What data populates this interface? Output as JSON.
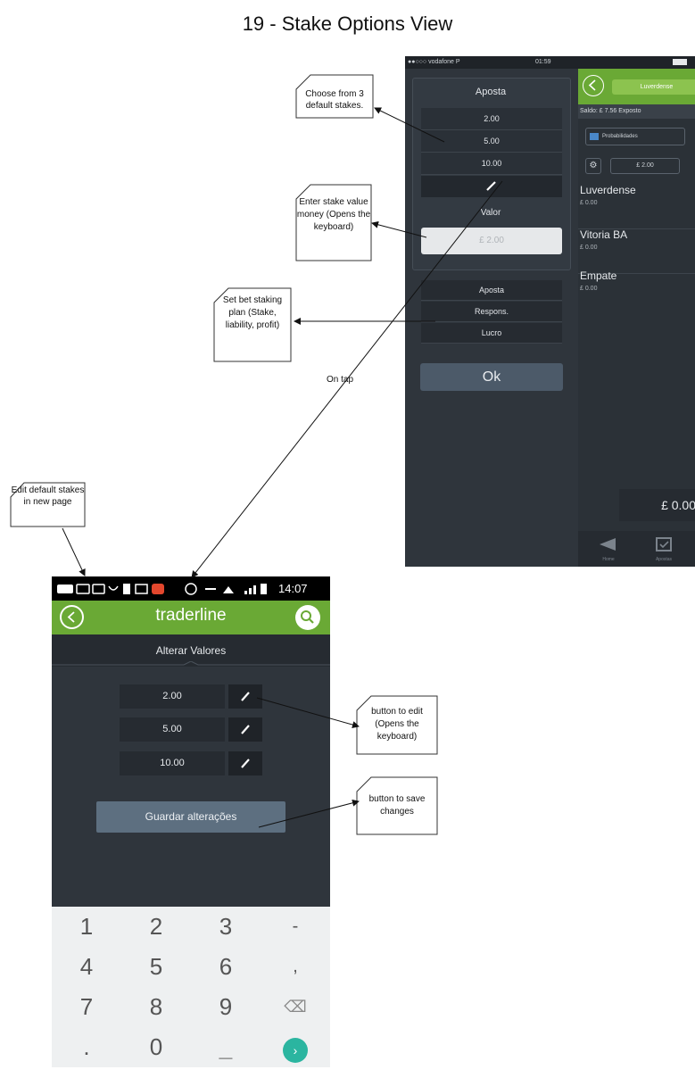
{
  "page": {
    "title": "19 - Stake Options View"
  },
  "ios": {
    "status": {
      "carrier": "●●○○○ vodafone P",
      "time": "01:59"
    },
    "popup": {
      "header": "Aposta",
      "default_stakes": [
        "2.00",
        "5.00",
        "10.00"
      ],
      "valor_label": "Valor",
      "valor_value": "£ 2.00",
      "plan_options": [
        "Aposta",
        "Respons.",
        "Lucro"
      ],
      "ok_label": "Ok"
    },
    "right": {
      "team_pill": "Luverdense",
      "saldo": "Saldo: £ 7.56    Exposto",
      "prob_label": "Probabilidades",
      "stake_value": "£ 2.00",
      "markets": [
        {
          "name": "Luverdense",
          "value": "£ 0.00"
        },
        {
          "name": "Vitoria BA",
          "value": "£ 0.00"
        },
        {
          "name": "Empate",
          "value": "£ 0.00"
        }
      ],
      "amount": "£ 0.00",
      "tabs": [
        "Home",
        "Apostas"
      ]
    }
  },
  "android": {
    "status_time": "14:07",
    "app_title": "traderline",
    "tab_title": "Alterar Valores",
    "stakes": [
      "2.00",
      "5.00",
      "10.00"
    ],
    "save_label": "Guardar alterações",
    "keyboard": [
      [
        "1",
        "2",
        "3",
        "-"
      ],
      [
        "4",
        "5",
        "6",
        ","
      ],
      [
        "7",
        "8",
        "9",
        "⌫"
      ],
      [
        ".",
        "0",
        "_",
        "›"
      ]
    ]
  },
  "callouts": {
    "choose": "Choose from 3 default stakes.",
    "enter": "Enter stake value money (Opens the keyboard)",
    "plan": "Set bet staking plan (Stake, liability, profit)",
    "ontap": "On tap",
    "editdefault": "Edit default stakes in new page",
    "editbtn": "button to edit (Opens the keyboard)",
    "savebtn": "button to save changes"
  },
  "colors": {
    "green": "#6aa935",
    "dark": "#2f353c",
    "teal": "#2bb5a0"
  }
}
